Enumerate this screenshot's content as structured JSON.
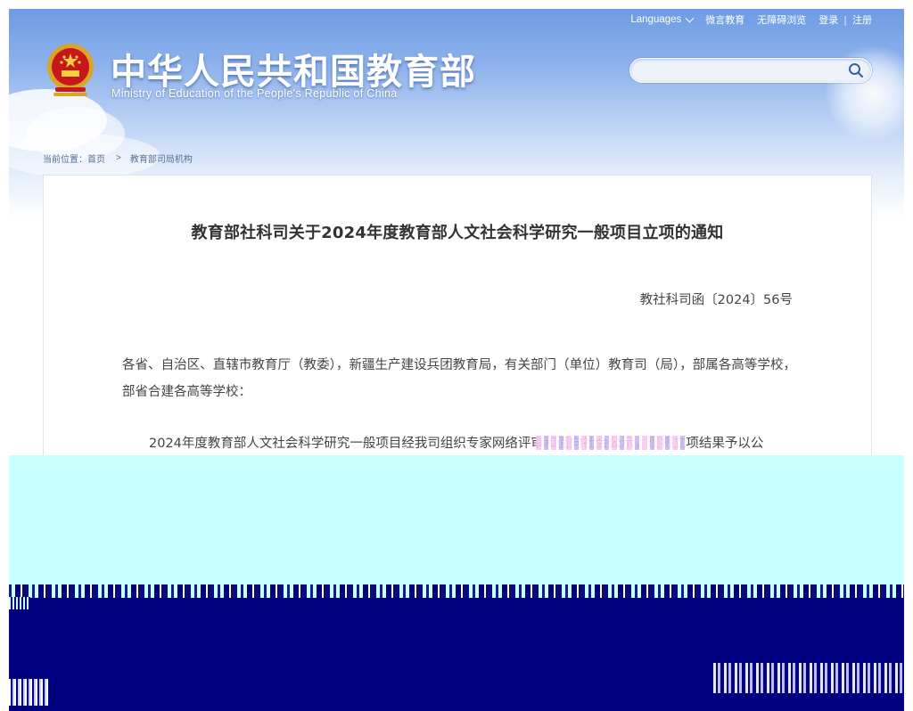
{
  "header": {
    "title_cn": "中华人民共和国教育部",
    "title_en": "Ministry of Education of the People's Republic of China",
    "emblem_icon": "national-emblem-icon"
  },
  "topnav": {
    "languages": "Languages",
    "weiyan": "微言教育",
    "accessible": "无障碍浏览",
    "login": "登录",
    "separator": "|",
    "register": "注册"
  },
  "search": {
    "placeholder": "",
    "icon": "search-icon"
  },
  "breadcrumb": {
    "prefix": "当前位置：",
    "home": "首页",
    "separator": ">",
    "section": "教育部司局机构"
  },
  "document": {
    "title": "教育部社科司关于2024年度教育部人文社会科学研究一般项目立项的通知",
    "number": "教社科司函〔2024〕56号",
    "recipients": "各省、自治区、直辖市教育厅（教委），新疆生产建设兵团教育局，有关部门（单位）教育司（局），部属各高等学校，部省合建各高等学校：",
    "body_start": "2024年度教育部人文社会科学研究一般项目经我司组织专家网络评审和面向社会公示，现将立项结果予以公"
  },
  "colors": {
    "banner_top": "#6f9be4",
    "text": "#444444",
    "glitch_cyan": "#c8ffff",
    "glitch_navy": "#000080"
  }
}
